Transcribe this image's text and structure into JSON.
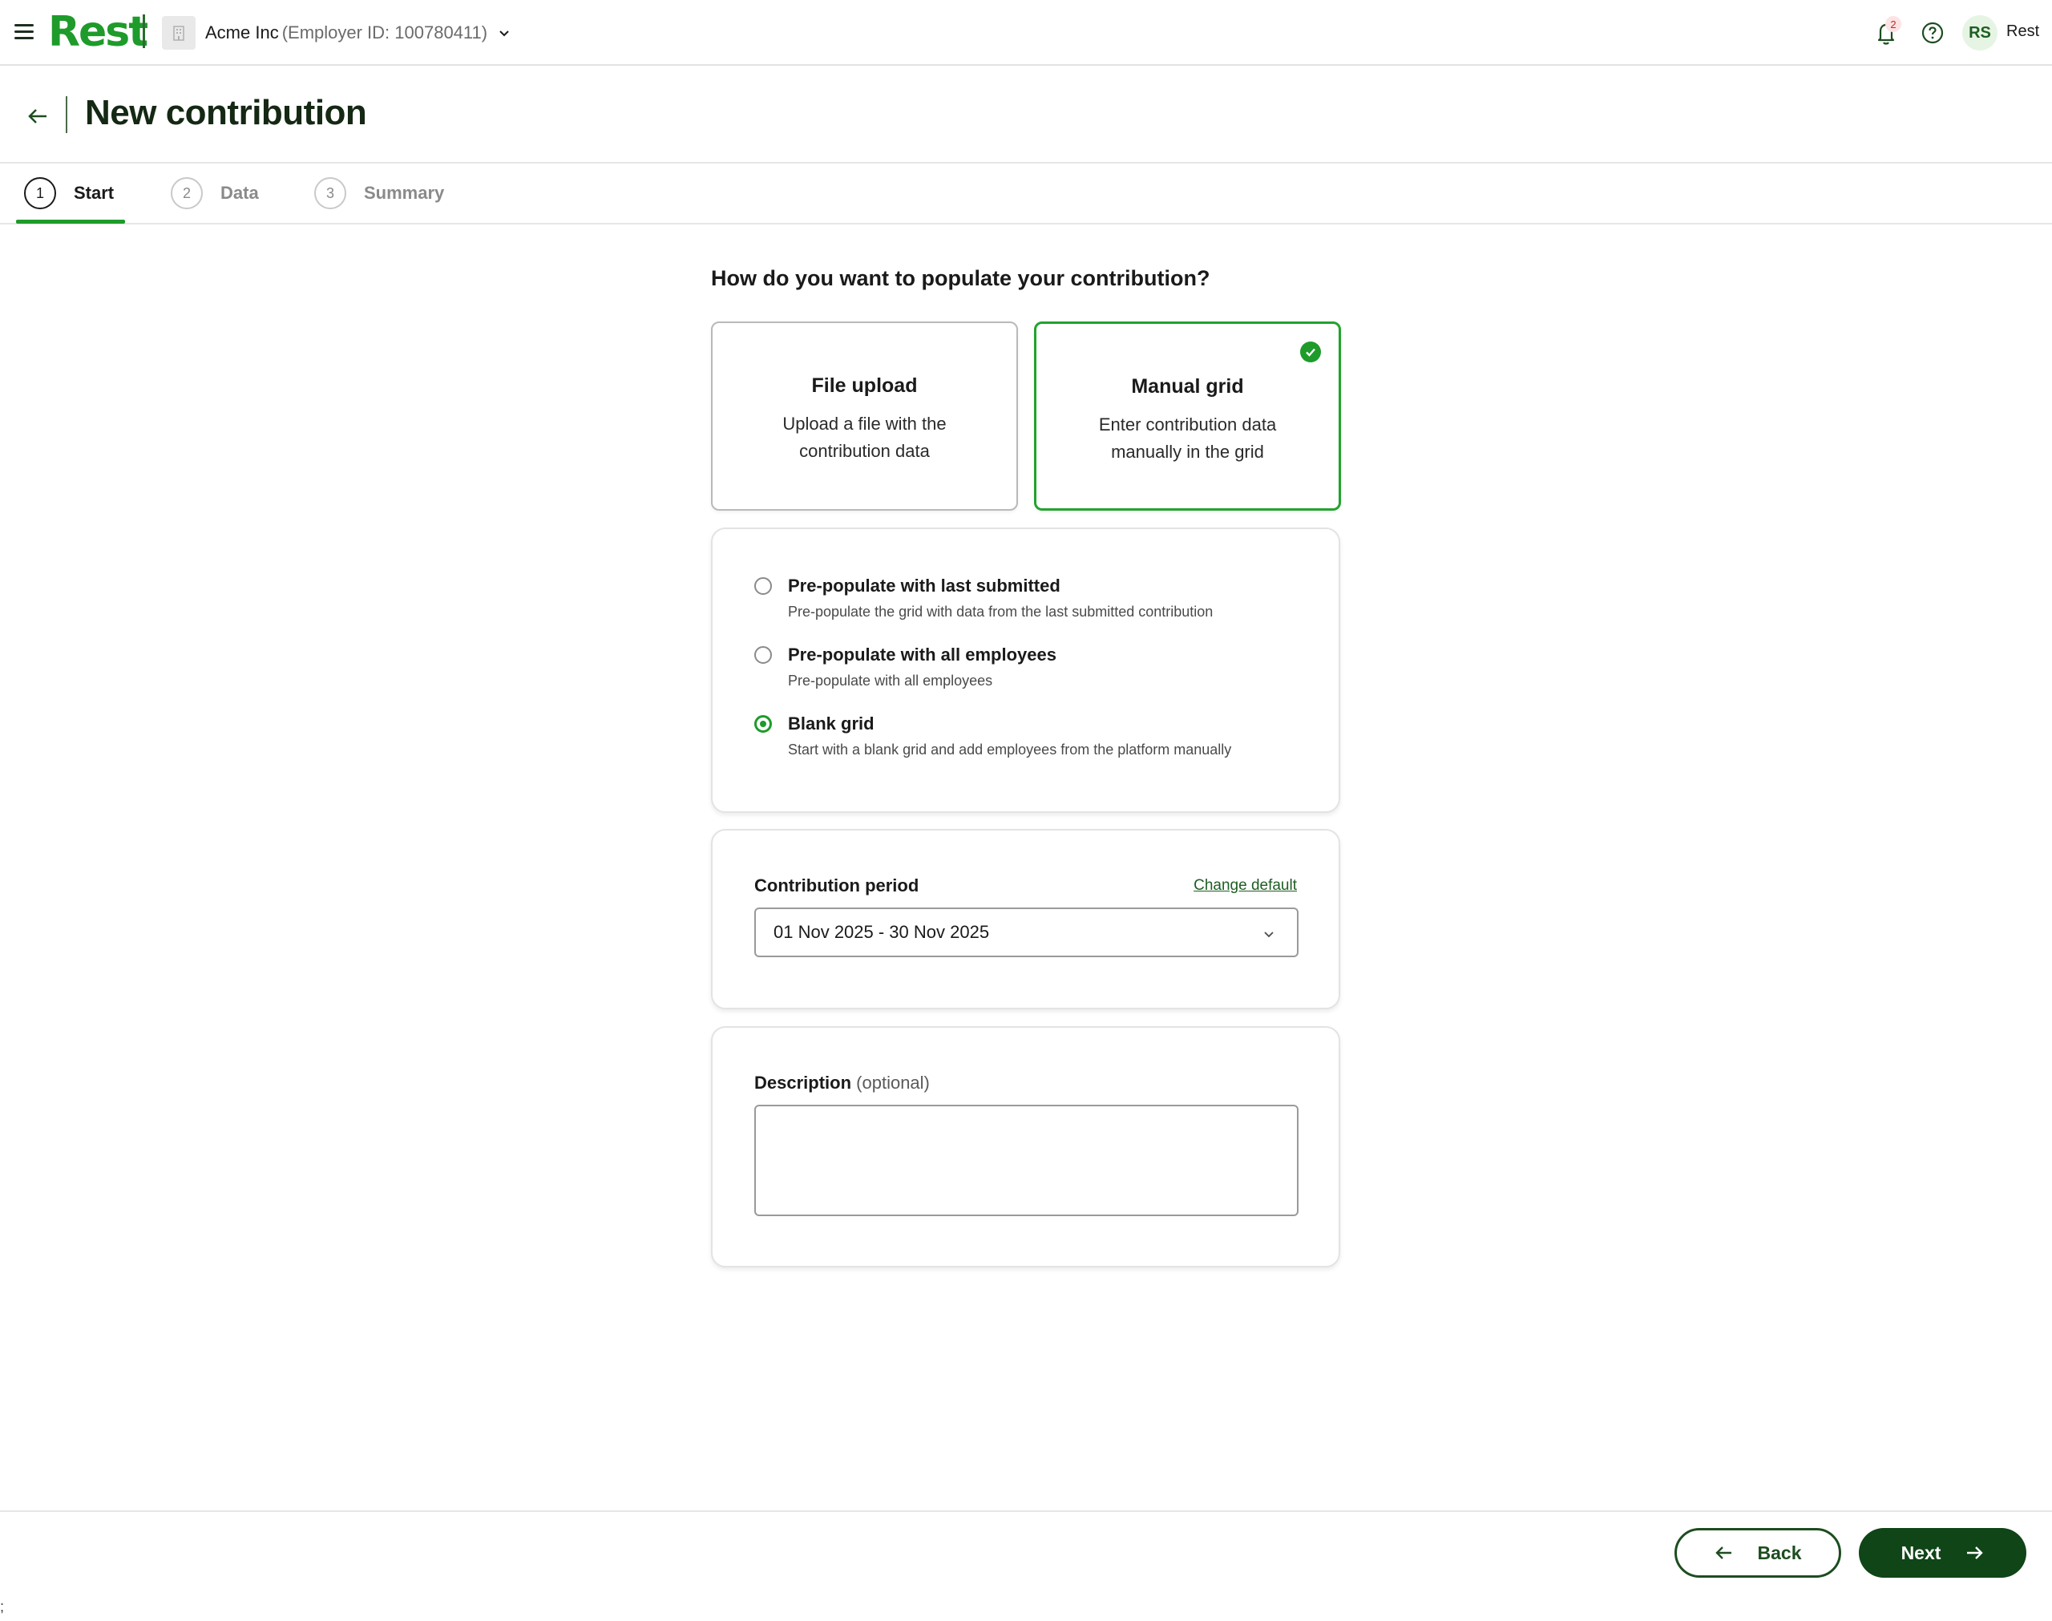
{
  "header": {
    "logo_text": "Rest",
    "employer_name": "Acme Inc",
    "employer_id": "(Employer ID: 100780411)",
    "notification_count": "2",
    "avatar_initials": "RS",
    "user_name": "Rest",
    "brand_color": "#1e9b2a"
  },
  "page": {
    "title": "New contribution"
  },
  "stepper": {
    "steps": [
      {
        "number": "1",
        "label": "Start",
        "active": true
      },
      {
        "number": "2",
        "label": "Data",
        "active": false
      },
      {
        "number": "3",
        "label": "Summary",
        "active": false
      }
    ]
  },
  "main": {
    "question": "How do you want to populate your contribution?",
    "methods": [
      {
        "title": "File upload",
        "description": "Upload a file with the contribution data",
        "selected": false
      },
      {
        "title": "Manual grid",
        "description": "Enter contribution data manually in the grid",
        "selected": true
      }
    ],
    "grid_options": [
      {
        "title": "Pre-populate with last submitted",
        "description": "Pre-populate the grid with data from the last submitted contribution",
        "checked": false
      },
      {
        "title": "Pre-populate with all employees",
        "description": "Pre-populate with all employees",
        "checked": false
      },
      {
        "title": "Blank grid",
        "description": "Start with a blank grid and add employees from the platform manually",
        "checked": true
      }
    ],
    "contribution_period": {
      "label": "Contribution period",
      "change_default_link": "Change default",
      "selected_value": "01 Nov 2025 - 30 Nov 2025"
    },
    "description": {
      "label": "Description",
      "optional_label": "(optional)",
      "value": ""
    }
  },
  "footer": {
    "back_label": "Back",
    "next_label": "Next"
  },
  "stray_text": ";"
}
